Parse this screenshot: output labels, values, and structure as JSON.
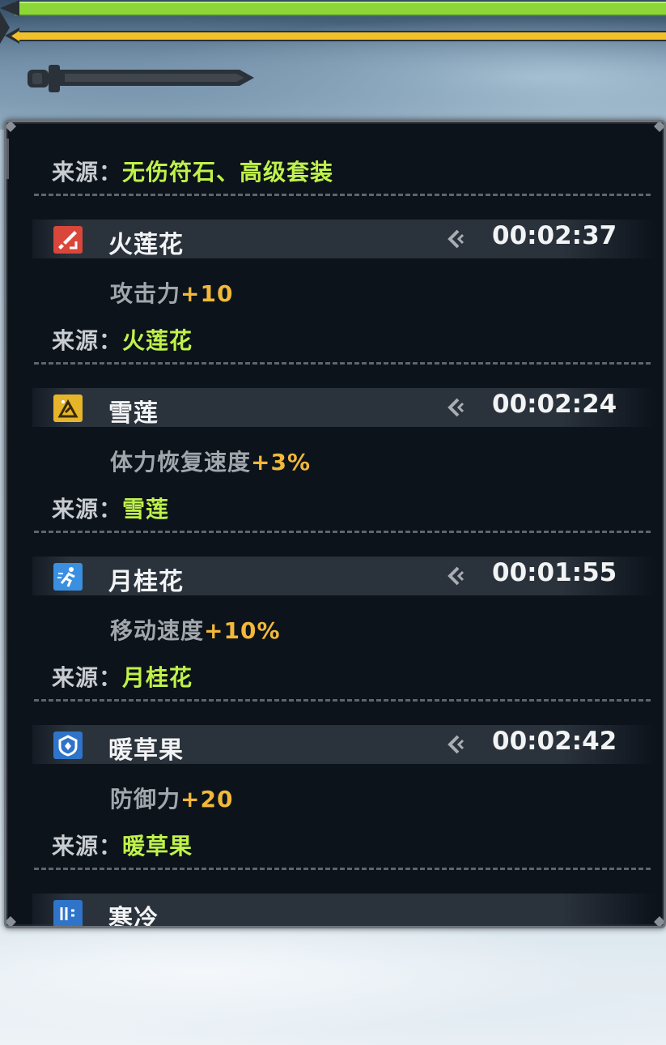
{
  "colors": {
    "source_value": "#bff24a",
    "bonus_value": "#f1b83a",
    "hp_bar": "#8cd63a",
    "stamina_bar": "#f2c12a",
    "panel_bg": "#0c131b"
  },
  "panel": {
    "top_source": {
      "label": "来源：",
      "value": "无伤符石、高级套装"
    },
    "buffs": [
      {
        "name": "火莲花",
        "icon": "sword-attack-icon",
        "icon_color": "#d8473a",
        "timer": "00:02:37",
        "effect_label": "攻击力",
        "effect_value": "+10",
        "source_label": "来源：",
        "source_value": "火莲花"
      },
      {
        "name": "雪莲",
        "icon": "stamina-recovery-icon",
        "icon_color": "#e6b52a",
        "timer": "00:02:24",
        "effect_label": "体力恢复速度",
        "effect_value": "+3%",
        "source_label": "来源：",
        "source_value": "雪莲"
      },
      {
        "name": "月桂花",
        "icon": "running-speed-icon",
        "icon_color": "#3a8fe0",
        "timer": "00:01:55",
        "effect_label": "移动速度",
        "effect_value": "+10%",
        "source_label": "来源：",
        "source_value": "月桂花"
      },
      {
        "name": "暖草果",
        "icon": "shield-defense-icon",
        "icon_color": "#2f74c9",
        "timer": "00:02:42",
        "effect_label": "防御力",
        "effect_value": "+20",
        "source_label": "来源：",
        "source_value": "暖草果"
      }
    ],
    "partial_buff": {
      "name": "寒冷",
      "icon": "cold-icon",
      "icon_color": "#2f74c9"
    }
  }
}
